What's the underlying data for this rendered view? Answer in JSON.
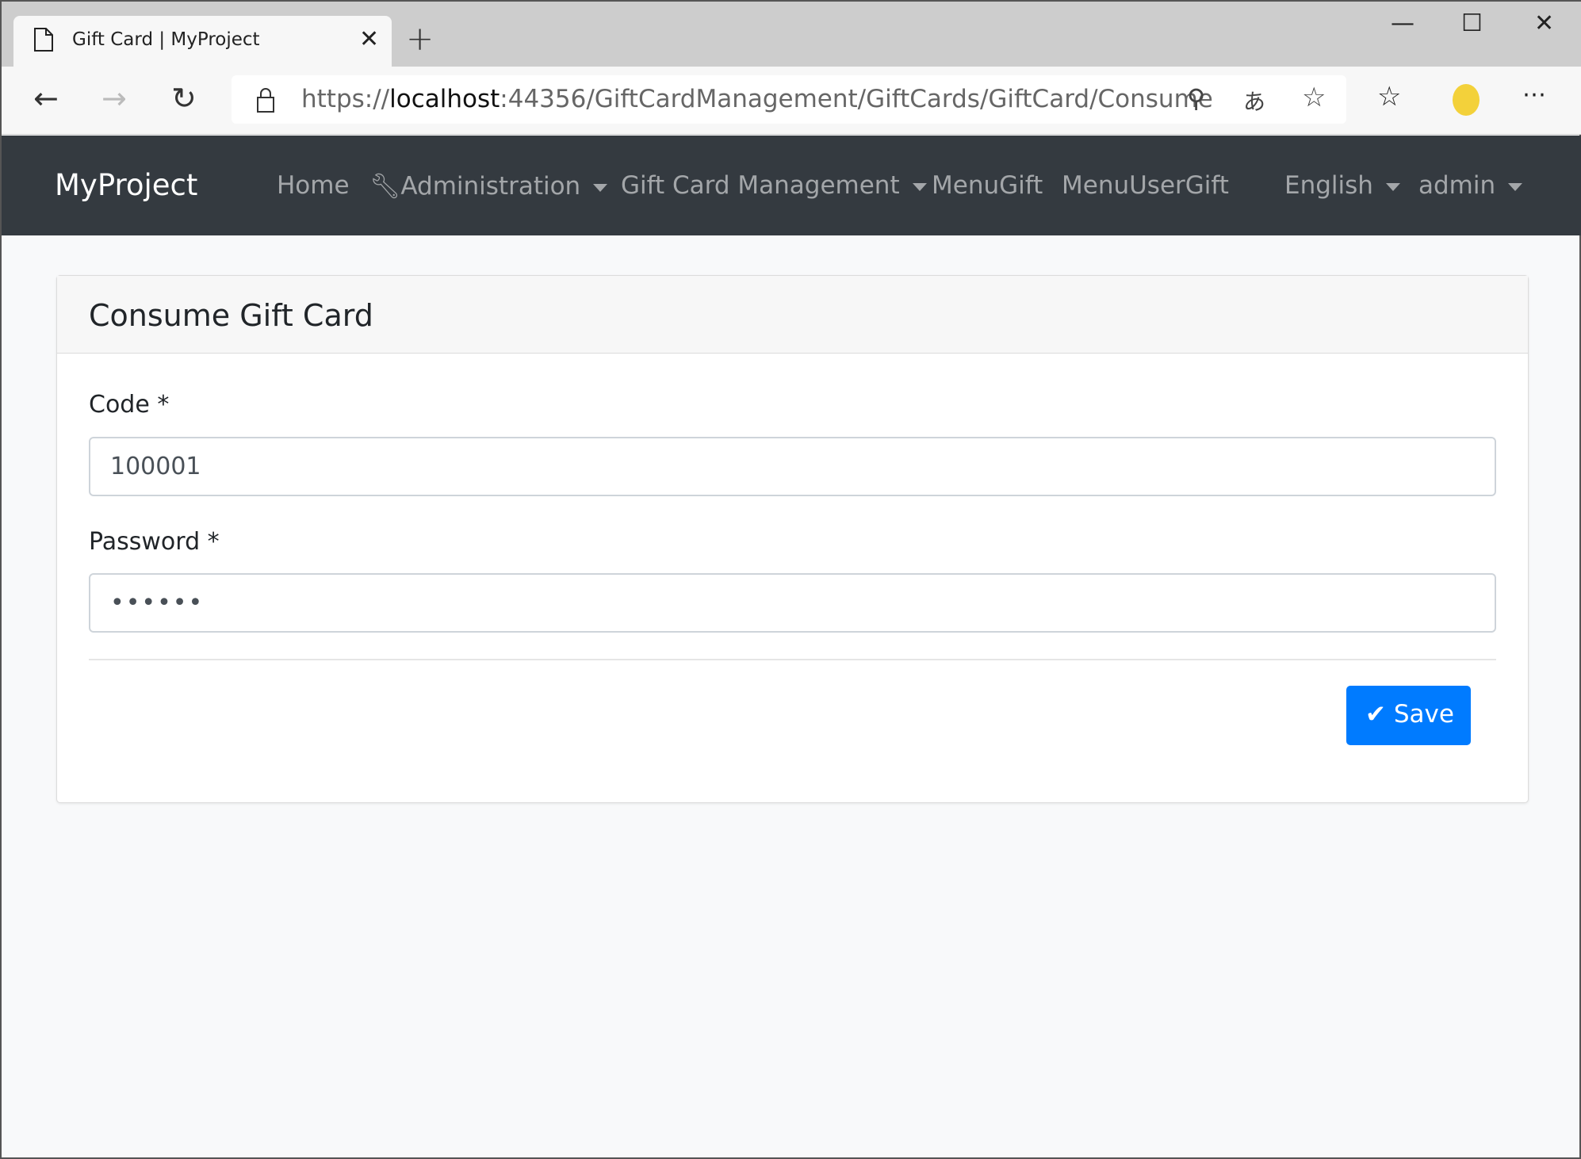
{
  "browser": {
    "tab_title": "Gift Card | MyProject",
    "url_prefix": "https://",
    "url_host": "localhost",
    "url_rest": ":44356/GiftCardManagement/GiftCards/GiftCard/Consume"
  },
  "navbar": {
    "brand": "MyProject",
    "items": [
      {
        "label": "Home"
      },
      {
        "label": "Administration"
      },
      {
        "label": "Gift Card Management"
      },
      {
        "label": "MenuGift"
      },
      {
        "label": "MenuUserGift"
      }
    ],
    "language": "English",
    "user": "admin"
  },
  "card": {
    "title": "Consume Gift Card",
    "code_label": "Code *",
    "code_value": "100001",
    "password_label": "Password *",
    "password_value": "••••••",
    "save_label": "Save"
  },
  "colors": {
    "navbar": "#343a40",
    "primary": "#007bff",
    "background": "#f8f9fa"
  }
}
